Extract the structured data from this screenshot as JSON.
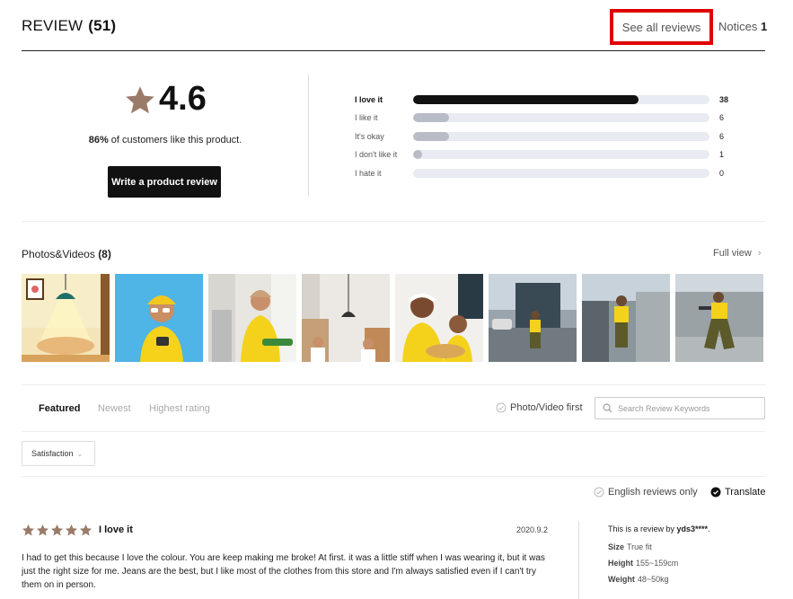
{
  "header": {
    "title": "REVIEW",
    "count": "(51)",
    "see_all_label": "See all reviews",
    "notices_label": "Notices",
    "notices_count": "1"
  },
  "summary": {
    "average": "4.6",
    "percent_value": "86%",
    "percent_text": " of customers like this product.",
    "write_button": "Write a product review",
    "distribution": [
      {
        "label": "I love it",
        "count": "38",
        "fraction": 0.76,
        "strong": true
      },
      {
        "label": "I like it",
        "count": "6",
        "fraction": 0.12,
        "strong": false
      },
      {
        "label": "It's okay",
        "count": "6",
        "fraction": 0.12,
        "strong": false
      },
      {
        "label": "I don't like it",
        "count": "1",
        "fraction": 0.03,
        "strong": false
      },
      {
        "label": "I hate it",
        "count": "0",
        "fraction": 0.0,
        "strong": false
      }
    ]
  },
  "photos": {
    "title": "Photos&Videos",
    "count": "(8)",
    "full_view": "Full view"
  },
  "sort": {
    "tabs": [
      "Featured",
      "Newest",
      "Highest rating"
    ],
    "active_tab": "Featured",
    "photo_first": "Photo/Video first",
    "search_placeholder": "Search Review Keywords"
  },
  "filters": {
    "satisfaction": "Satisfaction",
    "english_only": "English reviews only",
    "translate": "Translate"
  },
  "review": {
    "rating": 5,
    "title": "I love it",
    "date": "2020.9.2",
    "body": "I had to get this because I love the colour. You are keep making me broke! At first. it was a little stiff when I was wearing it, but it was just the right size for me. Jeans are the best, but I like most of the clothes from this store and I'm always satisfied even if I can't try them on in person.",
    "by_prefix": "This is a review by ",
    "by_user": "yds3****",
    "by_suffix": ".",
    "size_label": "Size",
    "size_value": "True fit",
    "height_label": "Height",
    "height_value": "155~159cm",
    "weight_label": "Weight",
    "weight_value": "48~50kg"
  },
  "colors": {
    "star": "#9a7b6a",
    "highlight": "#e00000",
    "bar_dark": "#111111",
    "bar_light": "#b8bcc6"
  }
}
